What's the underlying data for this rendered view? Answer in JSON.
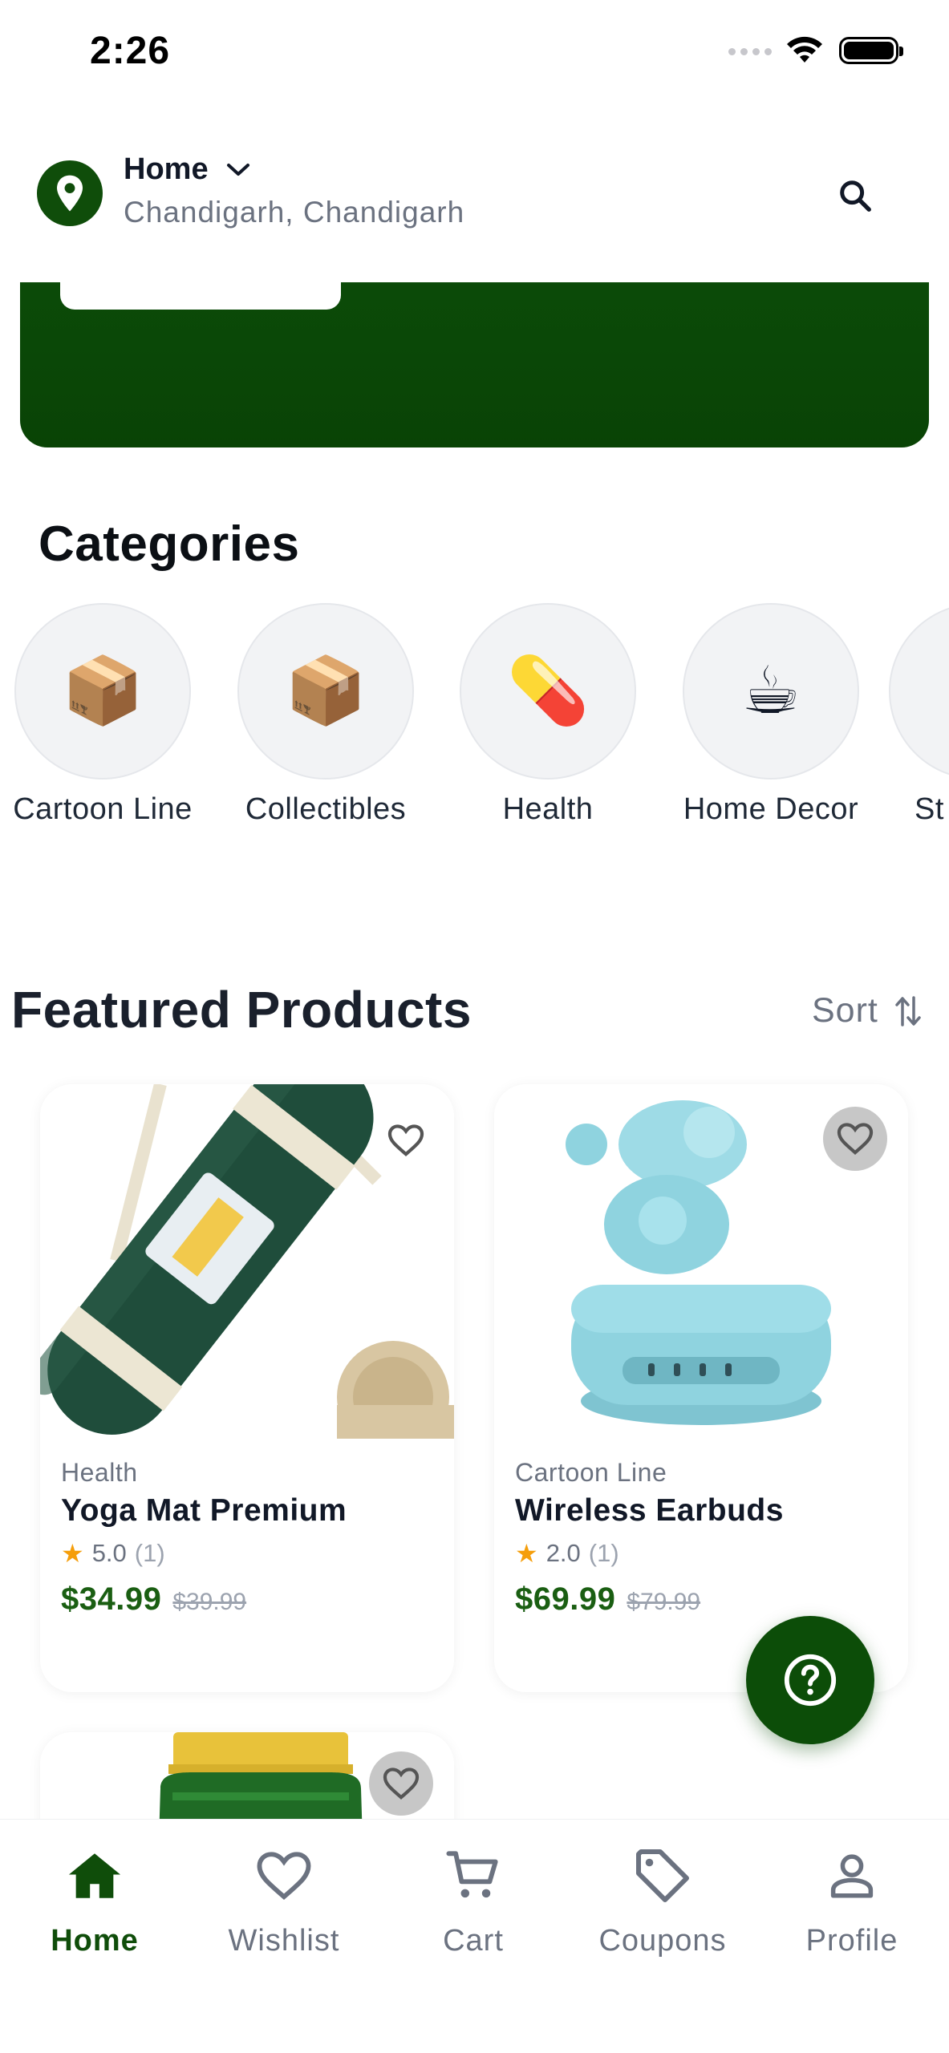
{
  "status_bar": {
    "time": "2:26"
  },
  "header": {
    "location_title": "Home",
    "location_subtitle": "Chandigarh, Chandigarh"
  },
  "categories": {
    "title": "Categories",
    "items": [
      {
        "label": "Cartoon Line",
        "icon": "📦"
      },
      {
        "label": "Collectibles",
        "icon": "📦"
      },
      {
        "label": "Health",
        "icon": "💊"
      },
      {
        "label": "Home Decor",
        "icon": "☕"
      },
      {
        "label": "St",
        "icon": ""
      }
    ]
  },
  "featured": {
    "title": "Featured Products",
    "sort_label": "Sort",
    "products": [
      {
        "category": "Health",
        "name": "Yoga Mat Premium",
        "rating": "5.0",
        "reviews": "(1)",
        "price": "$34.99",
        "original_price": "$39.99"
      },
      {
        "category": "Cartoon Line",
        "name": "Wireless Earbuds",
        "rating": "2.0",
        "reviews": "(1)",
        "price": "$69.99",
        "original_price": "$79.99"
      }
    ]
  },
  "bottom_nav": {
    "items": [
      {
        "label": "Home",
        "icon": "home-icon",
        "active": true
      },
      {
        "label": "Wishlist",
        "icon": "heart-icon",
        "active": false
      },
      {
        "label": "Cart",
        "icon": "cart-icon",
        "active": false
      },
      {
        "label": "Coupons",
        "icon": "tag-icon",
        "active": false
      },
      {
        "label": "Profile",
        "icon": "person-icon",
        "active": false
      }
    ]
  },
  "colors": {
    "brand_green": "#0c4d08",
    "price_green": "#1a5e12",
    "star": "#f59e0b"
  }
}
